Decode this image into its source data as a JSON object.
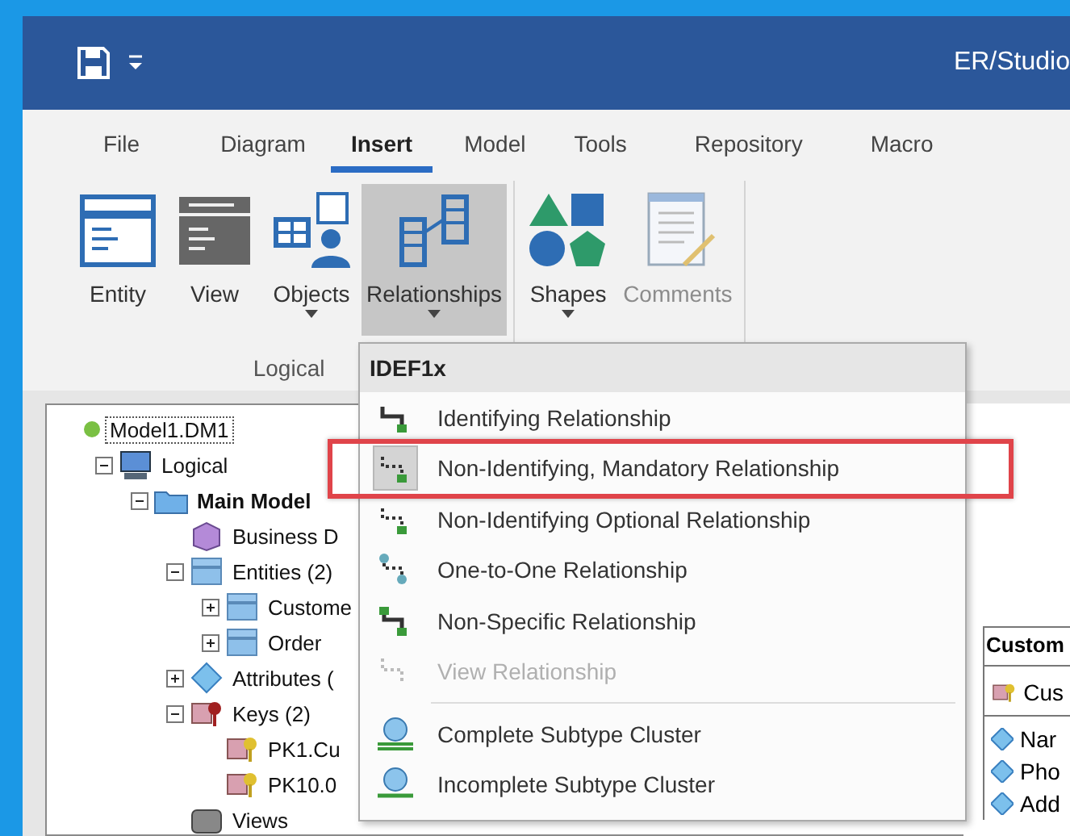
{
  "window": {
    "title": "ER/Studio"
  },
  "ribbon": {
    "tabs": [
      {
        "label": "File",
        "selected": false
      },
      {
        "label": "Diagram",
        "selected": false
      },
      {
        "label": "Insert",
        "selected": true
      },
      {
        "label": "Model",
        "selected": false
      },
      {
        "label": "Tools",
        "selected": false
      },
      {
        "label": "Repository",
        "selected": false
      },
      {
        "label": "Macro",
        "selected": false
      }
    ],
    "groups": [
      {
        "label": "Logical",
        "buttons": [
          {
            "label": "Entity",
            "kind": "entity",
            "dropdown": false,
            "pressed": false,
            "disabled": false
          },
          {
            "label": "View",
            "kind": "view",
            "dropdown": false,
            "pressed": false,
            "disabled": false
          },
          {
            "label": "Objects",
            "kind": "objects",
            "dropdown": true,
            "pressed": false,
            "disabled": false
          },
          {
            "label": "Relationships",
            "kind": "relationships",
            "dropdown": true,
            "pressed": true,
            "disabled": false
          }
        ]
      },
      {
        "buttons": [
          {
            "label": "Shapes",
            "kind": "shapes",
            "dropdown": true,
            "pressed": false,
            "disabled": false
          },
          {
            "label": "Comments",
            "kind": "comments",
            "dropdown": false,
            "pressed": false,
            "disabled": true
          }
        ]
      }
    ]
  },
  "tree": [
    {
      "label": "Model1.DM1",
      "kind": "model",
      "selected": true,
      "current": false,
      "children": [
        {
          "label": "Logical",
          "kind": "logical",
          "expanded": true,
          "selected": false,
          "current": false,
          "children": [
            {
              "label": "Main Model",
              "kind": "folder",
              "expanded": true,
              "selected": false,
              "current": true,
              "children": [
                {
                  "label": "Business D",
                  "kind": "business",
                  "selected": false,
                  "current": false
                },
                {
                  "label": "Entities (2)",
                  "kind": "entities",
                  "expanded": true,
                  "selected": false,
                  "current": false,
                  "children": [
                    {
                      "label": "Custome",
                      "kind": "entity",
                      "expanded": false,
                      "selected": false,
                      "current": false
                    },
                    {
                      "label": "Order",
                      "kind": "entity",
                      "expanded": false,
                      "selected": false,
                      "current": false
                    }
                  ]
                },
                {
                  "label": "Attributes (",
                  "kind": "attributes",
                  "expanded": false,
                  "selected": false,
                  "current": false
                },
                {
                  "label": "Keys (2)",
                  "kind": "keys",
                  "expanded": true,
                  "selected": false,
                  "current": false,
                  "children": [
                    {
                      "label": "PK1.Cu",
                      "kind": "key",
                      "selected": false,
                      "current": false
                    },
                    {
                      "label": "PK10.0",
                      "kind": "key",
                      "selected": false,
                      "current": false
                    }
                  ]
                },
                {
                  "label": "Views",
                  "kind": "views",
                  "selected": false,
                  "current": false
                }
              ]
            }
          ]
        }
      ]
    }
  ],
  "menu": {
    "title": "IDEF1x",
    "sections": [
      {
        "items": [
          {
            "label": "Identifying Relationship",
            "kind": "identifying",
            "selected": false,
            "disabled": false
          },
          {
            "label": "Non-Identifying, Mandatory Relationship",
            "kind": "mandatory",
            "selected": true,
            "disabled": false
          },
          {
            "label": "Non-Identifying Optional Relationship",
            "kind": "optional",
            "selected": false,
            "disabled": false
          },
          {
            "label": "One-to-One Relationship",
            "kind": "one-to-one",
            "selected": false,
            "disabled": false
          },
          {
            "label": "Non-Specific Relationship",
            "kind": "non-specific",
            "selected": false,
            "disabled": false
          },
          {
            "label": "View Relationship",
            "kind": "view",
            "selected": false,
            "disabled": true
          }
        ]
      },
      {
        "items": [
          {
            "label": "Complete Subtype Cluster",
            "kind": "complete",
            "selected": false,
            "disabled": false
          },
          {
            "label": "Incomplete Subtype Cluster",
            "kind": "incomplete",
            "selected": false,
            "disabled": false
          }
        ]
      }
    ]
  },
  "entity": {
    "name": "Custom",
    "keys": [
      "Cus"
    ],
    "attributes": [
      "Nar",
      "Pho",
      "Add"
    ]
  }
}
